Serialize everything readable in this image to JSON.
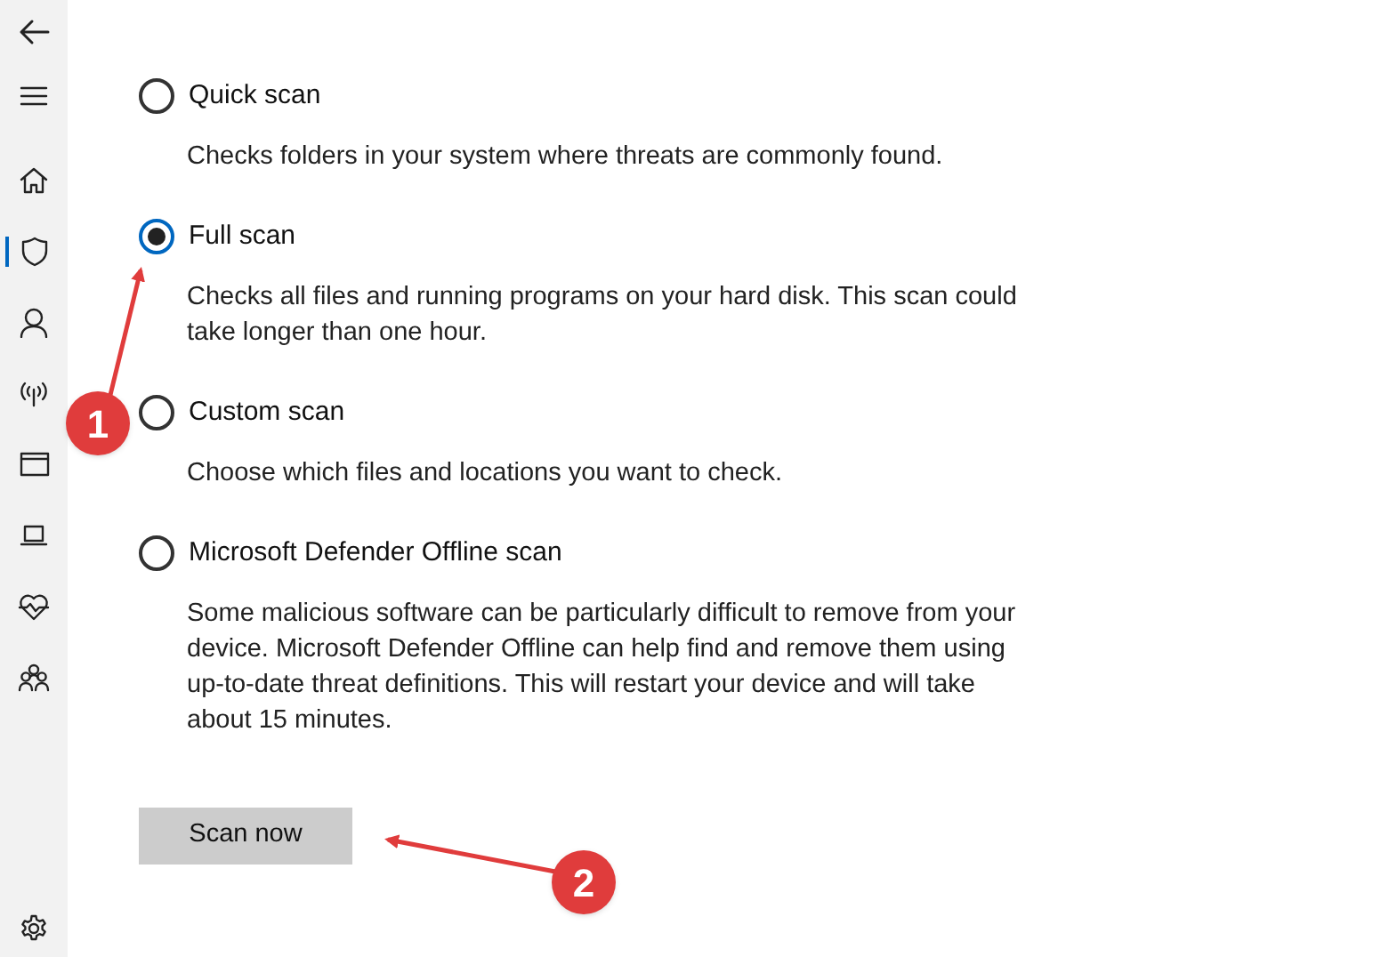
{
  "sidebar": {
    "items": [
      {
        "kind": "back",
        "selected": false
      },
      {
        "kind": "menu",
        "selected": false
      },
      {
        "kind": "home",
        "selected": false
      },
      {
        "kind": "shield",
        "selected": true
      },
      {
        "kind": "person",
        "selected": false
      },
      {
        "kind": "antenna",
        "selected": false
      },
      {
        "kind": "window",
        "selected": false
      },
      {
        "kind": "laptop",
        "selected": false
      },
      {
        "kind": "heart",
        "selected": false
      },
      {
        "kind": "family",
        "selected": false
      }
    ],
    "footer": {
      "kind": "settings",
      "selected": false
    }
  },
  "scan_options": [
    {
      "label": "Quick scan",
      "selected": false,
      "description": "Checks folders in your system where threats are commonly found."
    },
    {
      "label": "Full scan",
      "selected": true,
      "description": "Checks all files and running programs on your hard disk. This scan could take longer than one hour."
    },
    {
      "label": "Custom scan",
      "selected": false,
      "description": "Choose which files and locations you want to check."
    },
    {
      "label": "Microsoft Defender Offline scan",
      "selected": false,
      "description": "Some malicious software can be particularly difficult to remove from your device. Microsoft Defender Offline can help find and remove them using up-to-date threat definitions. This will restart your device and will take about 15 minutes."
    }
  ],
  "button": "Scan now",
  "callouts": [
    {
      "number": "1"
    },
    {
      "number": "2"
    }
  ]
}
